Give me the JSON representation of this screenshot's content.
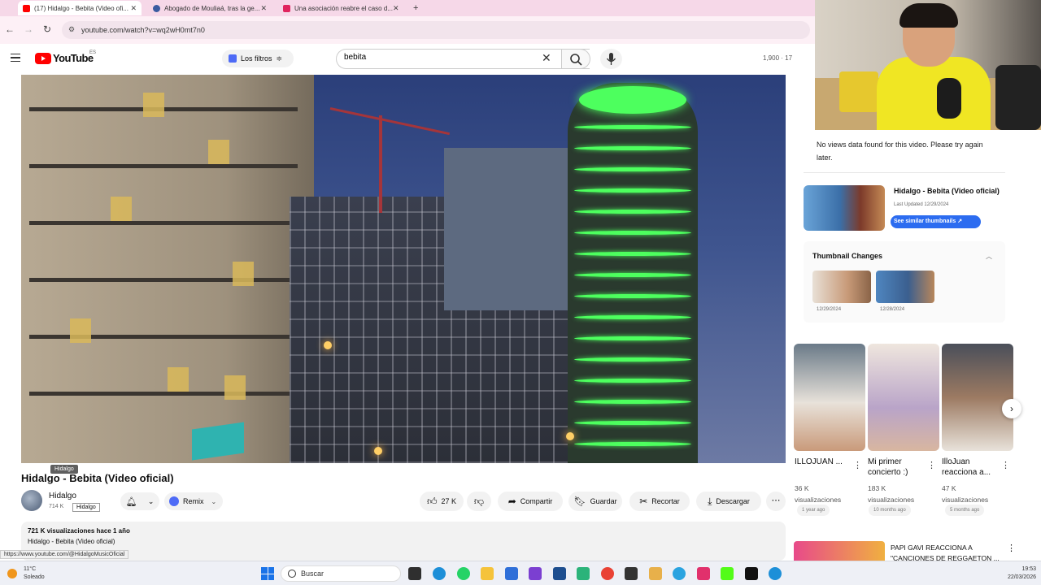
{
  "browser": {
    "tabs": [
      {
        "label": "(17) Hidalgo - Bebita (Video ofi...",
        "favicon_color": "#ff0000",
        "active": true
      },
      {
        "label": "Abogado de Mouliaá, tras la ge...",
        "favicon_color": "#3a5ba0",
        "active": false
      },
      {
        "label": "Una asociación reabre el caso d...",
        "favicon_color": "#e0245e",
        "active": false
      }
    ],
    "new_tab": "+",
    "url": "youtube.com/watch?v=wq2wH0mt7n0"
  },
  "header": {
    "logo_text": "YouTube",
    "logo_sup": "ES",
    "filters_label": "Los filtros",
    "search_value": "bebita",
    "counter": "1,900 · 17"
  },
  "video": {
    "title": "Hidalgo - Bebita (Video oficial)",
    "tooltip_channel": "Hidalgo",
    "channel_name": "Hidalgo",
    "channel_subs": "714 K",
    "tooltip_channel_2": "Hidalgo",
    "remix_label": "Remix",
    "likes": "27 K",
    "share_label": "Compartir",
    "save_label": "Guardar",
    "clip_label": "Recortar",
    "download_label": "Descargar",
    "views_line": "721 K visualizaciones  hace 1 año",
    "description": "Hidalgo - Bebita (Video oficial)",
    "status_url": "https://www.youtube.com/@HidalgoMusicOficial"
  },
  "sidebar": {
    "no_data": "No views data found for this video. Please try again later.",
    "thumb_title": "Hidalgo - Bebita (Video oficial)",
    "thumb_updated": "Last Updated 12/29/2024",
    "similar_label": "See similar thumbnails ↗",
    "changes_title": "Thumbnail Changes",
    "changes": [
      {
        "date": "12/29/2024",
        "color": "#c89a78"
      },
      {
        "date": "12/28/2024",
        "color": "#4f86c0"
      }
    ],
    "recs": [
      {
        "title": "ILLOJUAN ...",
        "views": "36 K",
        "unit": "visualizaciones",
        "time": "1 year ago",
        "color": "#6a7a88"
      },
      {
        "title": "Mi primer concierto :)",
        "views": "183 K",
        "unit": "visualizaciones",
        "time": "10 months ago",
        "color": "#b9a4c8"
      },
      {
        "title": "IlloJuan reacciona a...",
        "views": "47 K",
        "unit": "visualizaciones",
        "time": "5 months ago",
        "color": "#9c7a62"
      }
    ],
    "bottom_title": "PAPI GAVI REACCIONA A \"CANCIONES DE REGGAETON ..."
  },
  "taskbar": {
    "temp": "11°C",
    "weather": "Soleado",
    "search": "Buscar",
    "time": "19:53",
    "date": "22/03/2026"
  }
}
